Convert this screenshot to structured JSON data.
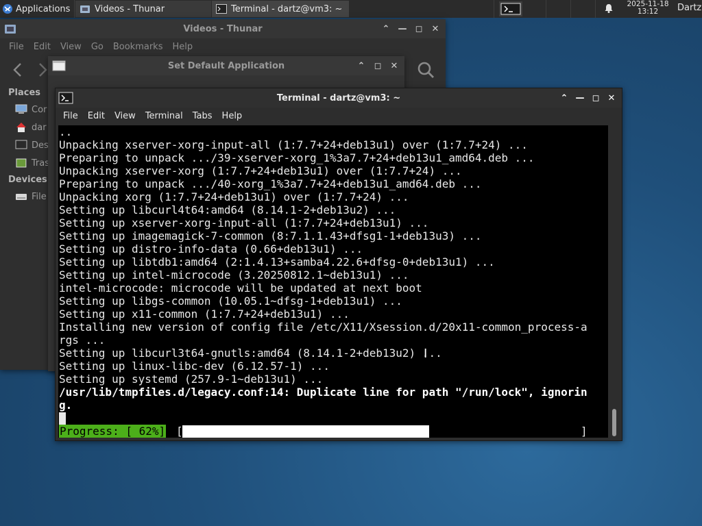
{
  "panel": {
    "applications_label": "Applications",
    "tasks": [
      {
        "label": "Videos - Thunar",
        "icon": "folder-icon"
      },
      {
        "label": "Terminal - dartz@vm3: ~",
        "icon": "terminal-icon"
      }
    ],
    "clock_date": "2025-11-18",
    "clock_time": "13:12",
    "user": "Dartz"
  },
  "thunar": {
    "title": "Videos - Thunar",
    "menu": [
      "File",
      "Edit",
      "View",
      "Go",
      "Bookmarks",
      "Help"
    ],
    "sidebar": {
      "places_header": "Places",
      "places": [
        "Cor",
        "dar",
        "Des",
        "Tras"
      ],
      "devices_header": "Devices",
      "devices": [
        "File"
      ]
    }
  },
  "dialog": {
    "title": "Set Default Application"
  },
  "terminal": {
    "title": "Terminal - dartz@vm3: ~",
    "menu": [
      "File",
      "Edit",
      "View",
      "Terminal",
      "Tabs",
      "Help"
    ],
    "lines": [
      {
        "text": "..",
        "bold": false
      },
      {
        "text": "Unpacking xserver-xorg-input-all (1:7.7+24+deb13u1) over (1:7.7+24) ...",
        "bold": false
      },
      {
        "text": "Preparing to unpack .../39-xserver-xorg_1%3a7.7+24+deb13u1_amd64.deb ...",
        "bold": false
      },
      {
        "text": "Unpacking xserver-xorg (1:7.7+24+deb13u1) over (1:7.7+24) ...",
        "bold": false
      },
      {
        "text": "Preparing to unpack .../40-xorg_1%3a7.7+24+deb13u1_amd64.deb ...",
        "bold": false
      },
      {
        "text": "Unpacking xorg (1:7.7+24+deb13u1) over (1:7.7+24) ...",
        "bold": false
      },
      {
        "text": "Setting up libcurl4t64:amd64 (8.14.1-2+deb13u2) ...",
        "bold": false
      },
      {
        "text": "Setting up xserver-xorg-input-all (1:7.7+24+deb13u1) ...",
        "bold": false
      },
      {
        "text": "Setting up imagemagick-7-common (8:7.1.1.43+dfsg1-1+deb13u3) ...",
        "bold": false
      },
      {
        "text": "Setting up distro-info-data (0.66+deb13u1) ...",
        "bold": false
      },
      {
        "text": "Setting up libtdb1:amd64 (2:1.4.13+samba4.22.6+dfsg-0+deb13u1) ...",
        "bold": false
      },
      {
        "text": "Setting up intel-microcode (3.20250812.1~deb13u1) ...",
        "bold": false
      },
      {
        "text": "intel-microcode: microcode will be updated at next boot",
        "bold": false
      },
      {
        "text": "Setting up libgs-common (10.05.1~dfsg-1+deb13u1) ...",
        "bold": false
      },
      {
        "text": "Setting up x11-common (1:7.7+24+deb13u1) ...",
        "bold": false
      },
      {
        "text": "Installing new version of config file /etc/X11/Xsession.d/20x11-common_process-a",
        "bold": false
      },
      {
        "text": "rgs ...",
        "bold": false
      },
      {
        "text": "Setting up libcurl3t64-gnutls:amd64 (8.14.1-2+deb13u2) ...",
        "bold": false
      },
      {
        "text": "Setting up linux-libc-dev (6.12.57-1) ...",
        "bold": false
      },
      {
        "text": "Setting up systemd (257.9-1~deb13u1) ...",
        "bold": false
      },
      {
        "text": "/usr/lib/tmpfiles.d/legacy.conf:14: Duplicate line for path \"/run/lock\", ignorin",
        "bold": true
      },
      {
        "text": "g.",
        "bold": true
      }
    ],
    "progress_label": "Progress: [ 62%]",
    "progress_fraction": 0.62,
    "progress_open": "[",
    "progress_close": "]"
  }
}
